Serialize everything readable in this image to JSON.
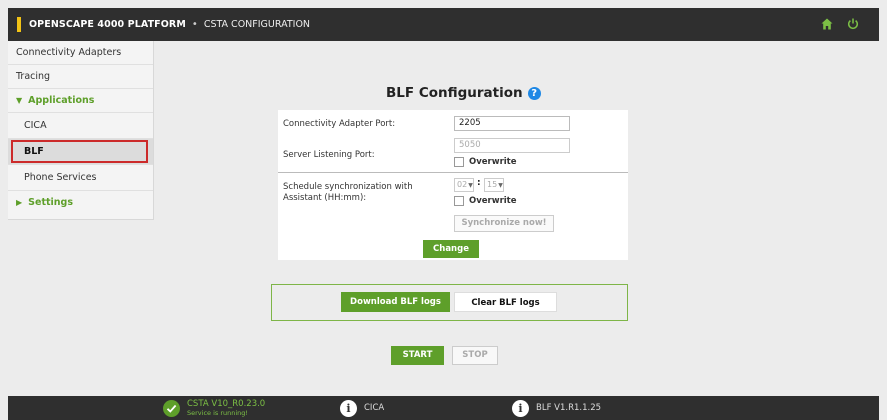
{
  "header": {
    "brand": "OPENSCAPE 4000 PLATFORM",
    "separator": "•",
    "crumb": "CSTA CONFIGURATION",
    "icons": [
      "home-icon",
      "power-icon"
    ]
  },
  "sidebar": {
    "items": [
      {
        "label": "Connectivity Adapters"
      },
      {
        "label": "Tracing"
      },
      {
        "label": "Applications"
      },
      {
        "label": "CICA"
      },
      {
        "label": "BLF"
      },
      {
        "label": "Phone Services"
      },
      {
        "label": "Settings"
      }
    ]
  },
  "main": {
    "title": "BLF Configuration",
    "help_icon": "help-icon",
    "adapter_port_label": "Connectivity Adapter Port:",
    "adapter_port_value": "2205",
    "server_port_label": "Server Listening Port:",
    "server_port_value": "5050",
    "overwrite_label": "Overwrite",
    "schedule_label": "Schedule synchronization with Assistant (HH:mm):",
    "hour_value": "02",
    "minute_value": "15",
    "time_sep": ":",
    "overwrite2_label": "Overwrite",
    "sync_now_label": "Synchronize now!",
    "change_label": "Change"
  },
  "logs": {
    "download_label": "Download BLF logs",
    "clear_label": "Clear BLF logs"
  },
  "controls": {
    "start_label": "START",
    "stop_label": "STOP"
  },
  "footer": {
    "csta_label": "CSTA",
    "csta_version": "V10_R0.23.0",
    "csta_status": "Service is running!",
    "cica_label": "CICA",
    "blf_label": "BLF V1.R1.1.25"
  },
  "colors": {
    "accent_green": "#5e9f2a",
    "brand_yellow": "#f2c316",
    "highlight_red": "#cc2a2a",
    "help_blue": "#1e88e5"
  }
}
